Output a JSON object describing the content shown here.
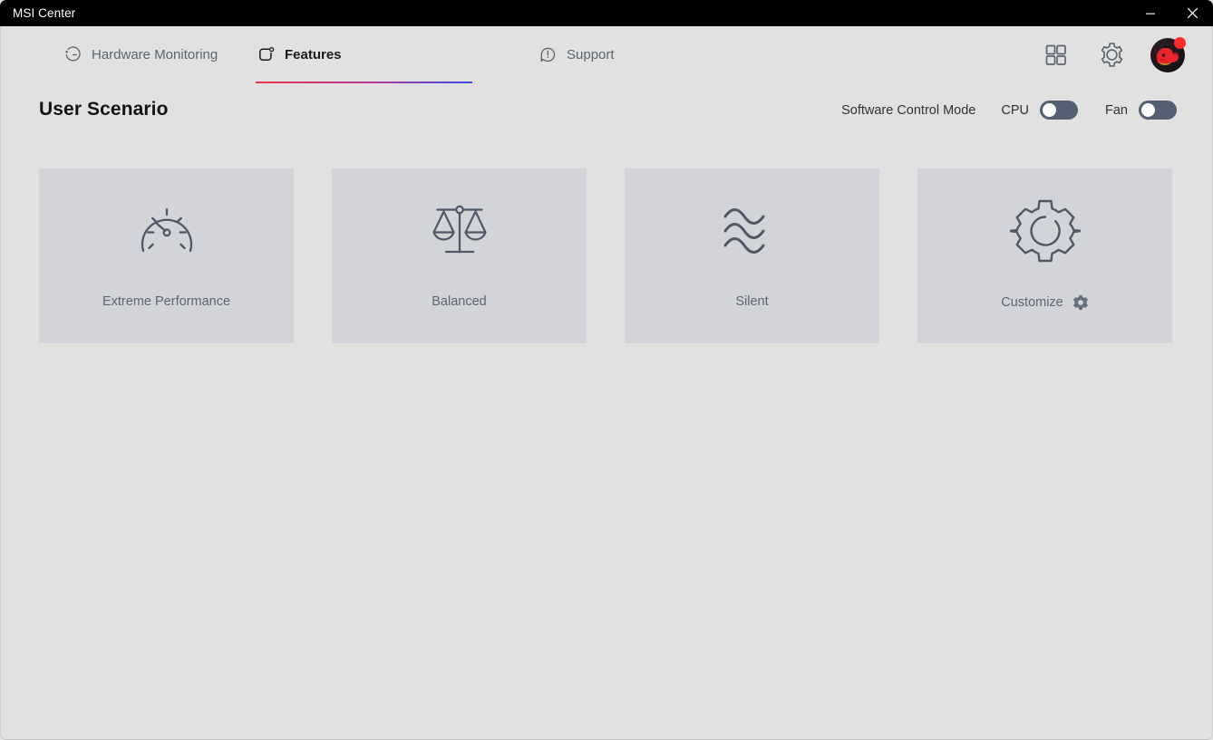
{
  "window": {
    "title": "MSI Center",
    "controls": [
      {
        "name": "minimize",
        "glyph": "minimize-icon"
      },
      {
        "name": "close",
        "glyph": "close-icon"
      }
    ]
  },
  "nav": {
    "tabs": [
      {
        "id": "hardware-monitoring",
        "label": "Hardware Monitoring",
        "icon": "gauge-circle-icon",
        "active": false
      },
      {
        "id": "features",
        "label": "Features",
        "icon": "feature-square-icon",
        "active": true
      },
      {
        "id": "support",
        "label": "Support",
        "icon": "speech-bubble-alert-icon",
        "active": false
      }
    ],
    "actions": [
      {
        "id": "apps",
        "icon": "grid-apps-icon"
      },
      {
        "id": "settings",
        "icon": "gear-icon"
      },
      {
        "id": "avatar",
        "icon": "dragon-avatar-icon",
        "has_notification": true
      }
    ],
    "active_tab_underline_colors": [
      "#f0354a",
      "#b03a9b",
      "#3a4be0"
    ]
  },
  "section": {
    "title": "User Scenario",
    "control_mode_label": "Software Control Mode",
    "toggles": [
      {
        "id": "cpu",
        "label": "CPU",
        "state": "off"
      },
      {
        "id": "fan",
        "label": "Fan",
        "state": "off"
      }
    ]
  },
  "scenarios": [
    {
      "id": "extreme-performance",
      "label": "Extreme Performance",
      "icon": "speedometer-icon",
      "has_settings_gear": false
    },
    {
      "id": "balanced",
      "label": "Balanced",
      "icon": "balance-scale-icon",
      "has_settings_gear": false
    },
    {
      "id": "silent",
      "label": "Silent",
      "icon": "waves-icon",
      "has_settings_gear": false
    },
    {
      "id": "customize",
      "label": "Customize",
      "icon": "gear-outline-icon",
      "has_settings_gear": true
    }
  ],
  "colors": {
    "titlebar_bg": "#000000",
    "page_bg": "#e1e1e1",
    "card_bg": "#d2d4d9",
    "icon_stroke": "#4e5866",
    "toggle_track": "#545f71",
    "accent_red": "#f0354a",
    "accent_blue": "#3a4be0"
  }
}
